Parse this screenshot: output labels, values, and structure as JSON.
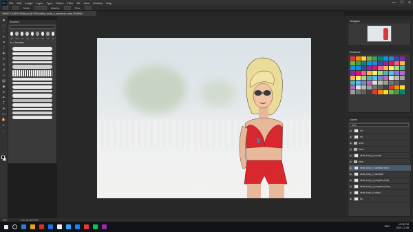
{
  "menu": {
    "app_logo": "Ps",
    "items": [
      "File",
      "Edit",
      "Image",
      "Layer",
      "Type",
      "Select",
      "Filter",
      "3D",
      "View",
      "Window",
      "Help"
    ],
    "window_controls": [
      "—",
      "❐",
      "✕"
    ]
  },
  "options_bar": {
    "mode_label": "Mode:",
    "opacity_label": "Opacity:",
    "flow_label": "Flow:"
  },
  "document": {
    "tab_title": "OHME CASEE 5658.psd @ 53% (olivia_body_b_swimsuit_sexy, RGB/8) *"
  },
  "brushes_panel": {
    "title": "Brushes",
    "preset_sizes": [
      "50",
      "300",
      "70",
      "45",
      "60",
      "10",
      "60",
      "40",
      "30"
    ],
    "folder_label": "brushes"
  },
  "navigator": {
    "title": "Navigator"
  },
  "swatches": {
    "title": "Swatches",
    "colors": [
      "#e53935",
      "#fb8c00",
      "#fdd835",
      "#7cb342",
      "#43a047",
      "#00897b",
      "#039be5",
      "#1e88e5",
      "#3949ab",
      "#8e24aa",
      "#d81b60",
      "#f06292",
      "#ffb74d",
      "#fff176",
      "#aed581",
      "#4db6ac",
      "#4fc3f7",
      "#7986cb",
      "#ba68c8",
      "#e0e0e0",
      "#bdbdbd",
      "#9e9e9e",
      "#757575",
      "#616161",
      "#424242"
    ]
  },
  "layers": {
    "title": "Layers",
    "search_text": "Kind",
    "rows": [
      {
        "name": "ref",
        "type": "layer",
        "selected": false
      },
      {
        "name": "ref",
        "type": "layer",
        "selected": false
      },
      {
        "name": "arms",
        "type": "folder",
        "selected": false
      },
      {
        "name": "faces",
        "type": "folder",
        "selected": false
      },
      {
        "name": "olivia_body_b_normal",
        "type": "layer",
        "selected": false
      },
      {
        "name": "body",
        "type": "folder",
        "selected": false
      },
      {
        "name": "olivia_body_b_swimsuit_sexy",
        "type": "layer",
        "selected": true
      },
      {
        "name": "olivia_body_b_swimsuit",
        "type": "layer",
        "selected": false
      },
      {
        "name": "olivia_body_b_pregnant_belly",
        "type": "layer",
        "selected": false
      },
      {
        "name": "olivia_body_b_pregnant_bump",
        "type": "layer",
        "selected": false
      },
      {
        "name": "olivia_body_b_naked",
        "type": "layer",
        "selected": false
      },
      {
        "name": "bg",
        "type": "layer",
        "selected": false
      }
    ]
  },
  "status": {
    "zoom": "53%",
    "doc_info": "Doc: 26.2M/1.96G"
  },
  "taskbar": {
    "time": "10:05 PM",
    "date": "2021-12-08",
    "lang": "ENG",
    "icon_colors": [
      "#2d7dd2",
      "#e8a317",
      "#d93025",
      "#1a73e8",
      "#f0f0f0",
      "#31a8ff",
      "#0a84ff",
      "#e53935",
      "#00c853",
      "#9c27b0"
    ]
  }
}
